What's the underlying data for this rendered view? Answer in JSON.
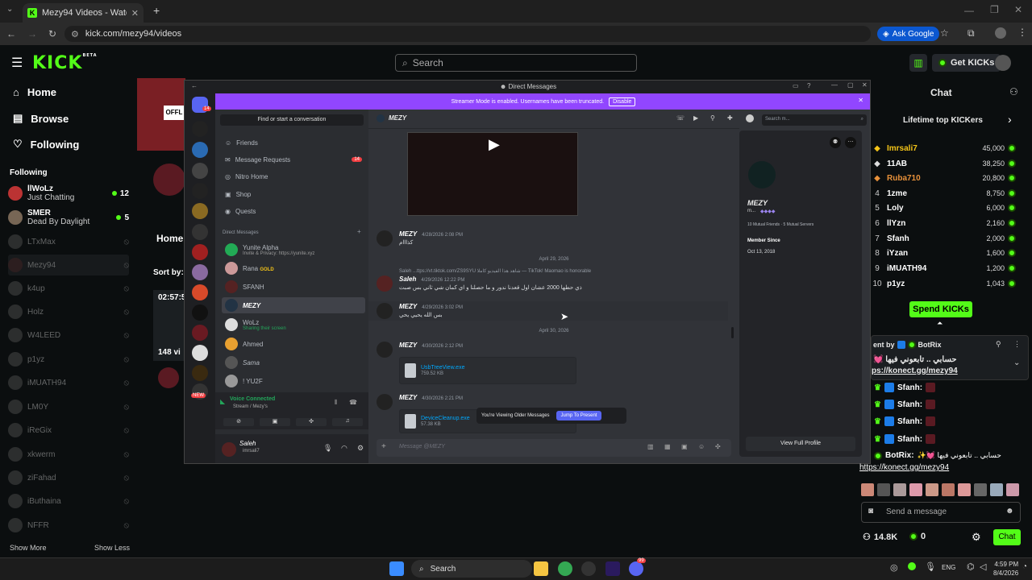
{
  "browser": {
    "tab_title": "Mezy94 Videos - Watch On-De",
    "url": "kick.com/mezy94/videos",
    "ask_google": "Ask Google"
  },
  "kick": {
    "logo": "KICK",
    "logo_badge": "BETA",
    "search_placeholder": "Search",
    "get_kicks": "Get KICKs",
    "nav": [
      {
        "label": "Home",
        "icon": "home-icon"
      },
      {
        "label": "Browse",
        "icon": "browse-icon"
      },
      {
        "label": "Following",
        "icon": "heart-icon"
      }
    ],
    "following_heading": "Following",
    "following": [
      {
        "name": "llWoLz",
        "sub": "Just Chatting",
        "viewers": "12",
        "live": true
      },
      {
        "name": "SMER",
        "sub": "Dead By Daylight",
        "viewers": "5",
        "live": true
      },
      {
        "name": "LTxMax",
        "sub": "",
        "viewers": "",
        "live": false
      },
      {
        "name": "Mezy94",
        "sub": "",
        "viewers": "",
        "live": false
      },
      {
        "name": "k4up",
        "sub": "",
        "viewers": "",
        "live": false
      },
      {
        "name": "Holz",
        "sub": "",
        "viewers": "",
        "live": false
      },
      {
        "name": "W4LEED",
        "sub": "",
        "viewers": "",
        "live": false
      },
      {
        "name": "p1yz",
        "sub": "",
        "viewers": "",
        "live": false
      },
      {
        "name": "iMUATH94",
        "sub": "",
        "viewers": "",
        "live": false
      },
      {
        "name": "LM0Y",
        "sub": "",
        "viewers": "",
        "live": false
      },
      {
        "name": "iReGix",
        "sub": "",
        "viewers": "",
        "live": false
      },
      {
        "name": "xkwerm",
        "sub": "",
        "viewers": "",
        "live": false
      },
      {
        "name": "ziFahad",
        "sub": "",
        "viewers": "",
        "live": false
      },
      {
        "name": "iButhaina",
        "sub": "",
        "viewers": "",
        "live": false
      },
      {
        "name": "NFFR",
        "sub": "",
        "viewers": "",
        "live": false
      }
    ],
    "show_more": "Show More",
    "show_less": "Show Less",
    "page_home_tab": "Home",
    "sort_by": "Sort by:",
    "video_duration": "02:57:5",
    "video_views": "148 vi"
  },
  "discord": {
    "window_title": "Direct Messages",
    "banner_text": "Streamer Mode is enabled. Usernames have been truncated.",
    "banner_button": "Disable",
    "find_placeholder": "Find or start a conversation",
    "menu": [
      {
        "label": "Friends",
        "badge": ""
      },
      {
        "label": "Message Requests",
        "badge": "14"
      },
      {
        "label": "Nitro Home",
        "badge": ""
      },
      {
        "label": "Shop",
        "badge": ""
      },
      {
        "label": "Quests",
        "badge": ""
      }
    ],
    "dm_heading": "Direct Messages",
    "dms": [
      {
        "name": "Yunite Alpha",
        "sub": "Invite & Privacy: https://yunite.xyz"
      },
      {
        "name": "Rana",
        "sub": "GOLD"
      },
      {
        "name": "SFANH",
        "sub": ""
      },
      {
        "name": "MEZY",
        "sub": ""
      },
      {
        "name": "WoLz",
        "sub": "Sharing their screen"
      },
      {
        "name": "Ahmed",
        "sub": ""
      },
      {
        "name": "Sama",
        "sub": ""
      },
      {
        "name": "! YU2F",
        "sub": ""
      }
    ],
    "voice_connected": "Voice Connected",
    "voice_sub": "Stream / Mezy's",
    "user_name": "Saleh",
    "user_sub": "imrsali7",
    "channel_name": "MEZY",
    "search_placeholder": "Search m...",
    "server_badge": "14",
    "new_badge": "NEW",
    "messages": [
      {
        "name": "MEZY",
        "time": "4/28/2026 2:08 PM",
        "text": "كذااام"
      },
      {
        "date": "April 29, 2026"
      },
      {
        "reply": "Saleh ...ttps://vt.tiktok.com/ZS9SYU شاهد هذا الفيديو كاملا — TikTok! Maomao is honorable"
      },
      {
        "name": "Saleh",
        "time": "4/29/2026 12:22 PM",
        "text": "ذي حطها 2000 عشان اول قعدنا ندور و ما حصلنا و اي كمان شي ثاني بس صبت"
      },
      {
        "name": "MEZY",
        "time": "4/29/2026 3:02 PM",
        "text": "بس الله يحيي يحي"
      },
      {
        "date": "April 30, 2026"
      },
      {
        "name": "MEZY",
        "time": "4/30/2026 2:12 PM",
        "file": "UsbTreeView.exe",
        "size": "759.52 KB"
      },
      {
        "name": "MEZY",
        "time": "4/30/2026 2:21 PM",
        "file": "DeviceCleanup.exe",
        "size": "57.38 KB"
      }
    ],
    "older_notice": "You're Viewing Older Messages",
    "jump_button": "Jump To Present",
    "input_placeholder": "Message @MEZY",
    "profile": {
      "name": "MEZY",
      "tag": "m...",
      "mutual_friends": "10 Mutual Friends",
      "mutual_servers": "5 Mutual Servers",
      "member_since_label": "Member Since",
      "member_since": "Oct 13, 2018",
      "view_full": "View Full Profile"
    }
  },
  "chat": {
    "title": "Chat",
    "leaderboard_title": "Lifetime top KICKers",
    "leaderboard": [
      {
        "rank": "",
        "name": "Imrsali7",
        "value": "45,000",
        "color": "#f5c518"
      },
      {
        "rank": "",
        "name": "11AB",
        "value": "38,250",
        "color": "#ffffff"
      },
      {
        "rank": "",
        "name": "Ruba710",
        "value": "20,800",
        "color": "#e8913a"
      },
      {
        "rank": "4",
        "name": "1zme",
        "value": "8,750",
        "color": "#ffffff"
      },
      {
        "rank": "5",
        "name": "Loly",
        "value": "6,000",
        "color": "#ffffff"
      },
      {
        "rank": "6",
        "name": "llYzn",
        "value": "2,160",
        "color": "#ffffff"
      },
      {
        "rank": "7",
        "name": "Sfanh",
        "value": "2,000",
        "color": "#ffffff"
      },
      {
        "rank": "8",
        "name": "iYzan",
        "value": "1,600",
        "color": "#ffffff"
      },
      {
        "rank": "9",
        "name": "iMUATH94",
        "value": "1,200",
        "color": "#ffffff"
      },
      {
        "rank": "10",
        "name": "p1yz",
        "value": "1,043",
        "color": "#ffffff"
      }
    ],
    "spend_button": "Spend KICKs",
    "pinned_by": "ent by",
    "pinned_user": "BotRix",
    "pinned_text": "حسابي .. تابعوني فيها",
    "pinned_link": "ps://konect.gg/mezy94",
    "messages": [
      {
        "user": "Sfanh:",
        "text": ""
      },
      {
        "user": "Sfanh:",
        "text": ""
      },
      {
        "user": "Sfanh:",
        "text": ""
      },
      {
        "user": "Sfanh:",
        "text": ""
      }
    ],
    "bot_user": "BotRix:",
    "bot_text": "حسابي .. تابعوني فيها",
    "bot_link": "https://konect.gg/mezy94",
    "send_placeholder": "Send a message",
    "followers": "14.8K",
    "kicks": "0",
    "chat_button": "Chat"
  },
  "taskbar": {
    "search": "Search",
    "lang": "ENG",
    "time": "4:59 PM",
    "date": "8/4/2026",
    "discord_badge": "99"
  }
}
